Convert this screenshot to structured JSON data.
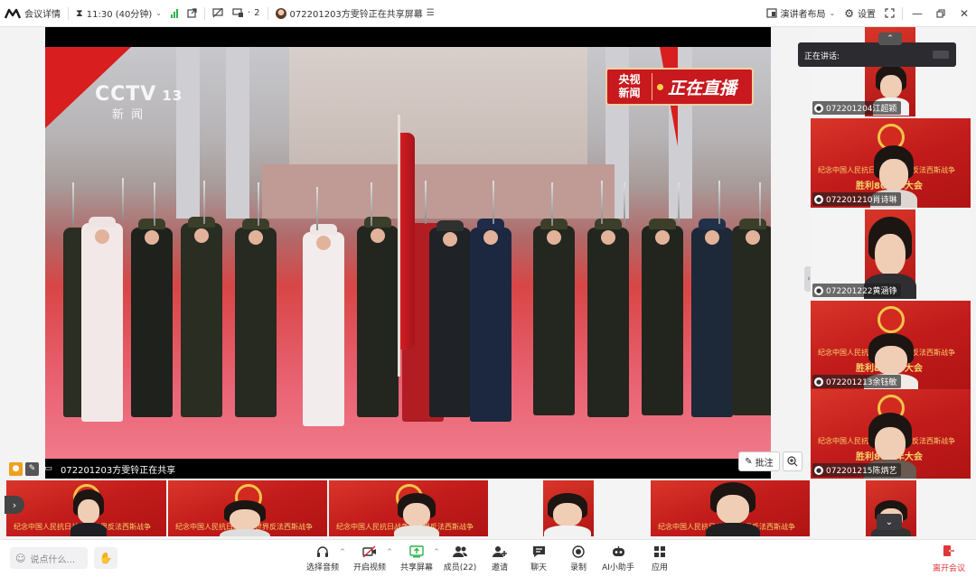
{
  "topbar": {
    "meeting_details": "会议详情",
    "timer": "11:30 (40分钟)",
    "participants_view_count": "2",
    "share_status": "072201203方雯铃正在共享屏幕",
    "speaker_layout": "演讲者布局",
    "settings": "设置"
  },
  "video": {
    "cctv_logo": "CCTV",
    "cctv_channel": "13",
    "cctv_sub": "新 闻",
    "badge_top": "央视",
    "badge_bottom": "新闻",
    "badge_live": "正在直播"
  },
  "share_bar": {
    "text": "072201203方雯铃正在共享",
    "annotate": "批注"
  },
  "speaking": {
    "label": "正在讲话:"
  },
  "banner": {
    "line1": "纪念中国人民抗日战争暨世界反法西斯战争",
    "line2": "胜利80周年大会"
  },
  "right_tiles": [
    {
      "name": "072201204江超颖"
    },
    {
      "name": "072201210肖诗琳"
    },
    {
      "name": "072201222黄涵铮"
    },
    {
      "name": "072201213余钰敏"
    },
    {
      "name": "072201215陈炳艺"
    }
  ],
  "toolbar": {
    "chat_placeholder": "说点什么...",
    "audio": "选择音频",
    "video": "开启视频",
    "share": "共享屏幕",
    "members": "成员(22)",
    "invite": "邀请",
    "chat": "聊天",
    "record": "录制",
    "ai": "AI小助手",
    "apps": "应用",
    "leave": "离开会议"
  },
  "colors": {
    "accent_red": "#d32a20",
    "leave_red": "#e0373a",
    "banner_gold": "#f6d36a",
    "signal_green": "#2bb24c"
  }
}
